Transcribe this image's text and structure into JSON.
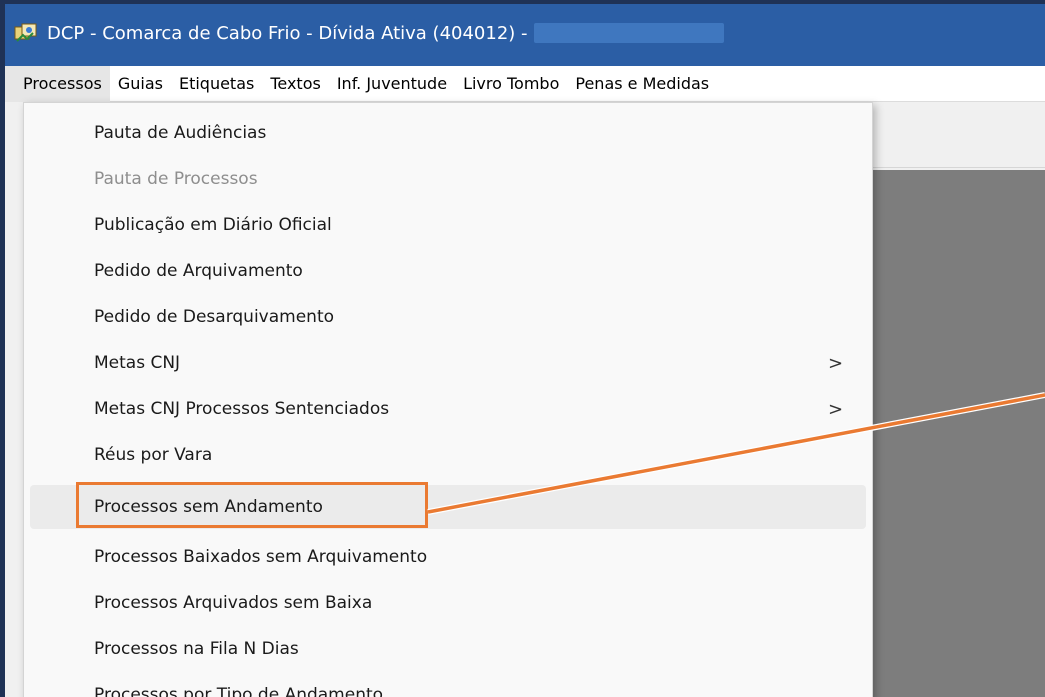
{
  "window": {
    "title": "DCP - Comarca de Cabo Frio - Dívida Ativa (404012) -",
    "icon": "app-icon",
    "colors": {
      "titlebar": "#2b5ea5",
      "desktop": "#1f3256",
      "highlight": "#ea7a32",
      "mdi": "#7d7d7d"
    }
  },
  "menubar": {
    "items": [
      {
        "label": "Processos"
      },
      {
        "label": "Guias"
      },
      {
        "label": "Etiquetas"
      },
      {
        "label": "Textos"
      },
      {
        "label": "Inf. Juventude"
      },
      {
        "label": "Livro Tombo"
      },
      {
        "label": "Penas e Medidas"
      }
    ]
  },
  "dropdown": {
    "items": [
      {
        "label": "Pauta de Audiências"
      },
      {
        "label": "Pauta de Processos",
        "disabled": true
      },
      {
        "label": "Publicação em Diário Oficial"
      },
      {
        "label": "Pedido de Arquivamento"
      },
      {
        "label": "Pedido de Desarquivamento"
      },
      {
        "label": "Metas CNJ",
        "submenu": true,
        "chevron": ">"
      },
      {
        "label": "Metas CNJ Processos Sentenciados",
        "submenu": true,
        "chevron": ">"
      },
      {
        "label": "Réus por Vara"
      },
      {
        "label": "Processos sem Andamento",
        "highlighted": true
      },
      {
        "label": "Processos Baixados sem Arquivamento"
      },
      {
        "label": "Processos Arquivados sem Baixa"
      },
      {
        "label": "Processos na Fila N Dias"
      },
      {
        "label": "Processos por Tipo de Andamento"
      }
    ]
  }
}
